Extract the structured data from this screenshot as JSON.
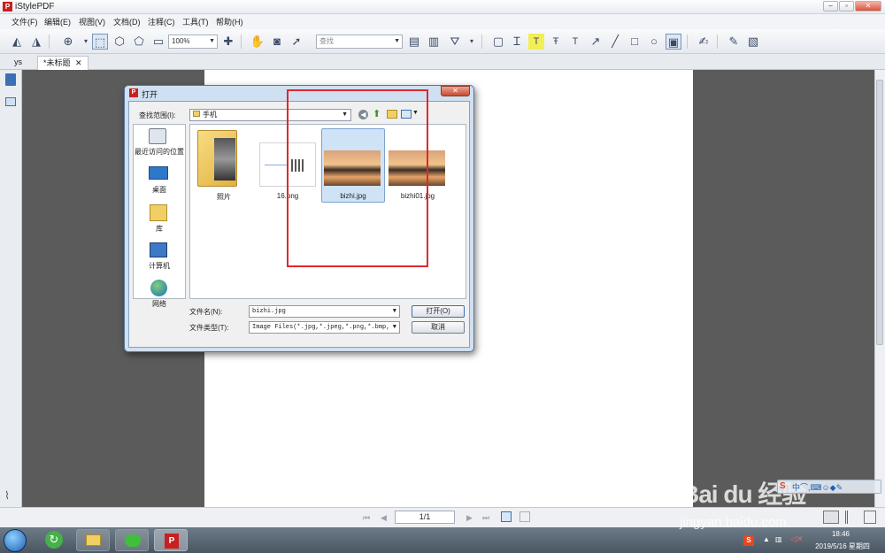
{
  "window": {
    "title": "iStylePDF",
    "buttons": [
      "minimize",
      "maximize",
      "close"
    ]
  },
  "menu": [
    "文件(F)",
    "编辑(E)",
    "视图(V)",
    "文档(D)",
    "注释(C)",
    "工具(T)",
    "帮助(H)"
  ],
  "toolbar": {
    "zoom_value": "100%",
    "search_placeholder": "查找"
  },
  "tabs": [
    "ys",
    "*未标题"
  ],
  "statusbar": {
    "page": "1/1"
  },
  "dialog": {
    "title": "打开",
    "lookin_label": "查找范围(I):",
    "lookin_value": "手机",
    "places": [
      "最近访问的位置",
      "桌面",
      "库",
      "计算机",
      "网络"
    ],
    "files": [
      {
        "name": "照片",
        "kind": "folder"
      },
      {
        "name": "16.png",
        "kind": "image"
      },
      {
        "name": "bizhi.jpg",
        "kind": "image",
        "selected": true
      },
      {
        "name": "bizhi01.jpg",
        "kind": "image"
      }
    ],
    "filename_label": "文件名(N):",
    "filename_value": "bizhi.jpg",
    "filetype_label": "文件类型(T):",
    "filetype_value": "Image Files(*.jpg,*.jpeg,*.png,*.bmp,",
    "open_button": "打开(O)",
    "cancel_button": "取消"
  },
  "taskbar": {
    "time": "18:46",
    "date": "2019/5/16 星期四"
  },
  "watermark": {
    "logo": "Bai du 经验",
    "url": "jingyan.baidu.com"
  },
  "colors": {
    "highlight": "#e0282d",
    "selection": "#cfe3f7",
    "app_red": "#c8201e"
  }
}
